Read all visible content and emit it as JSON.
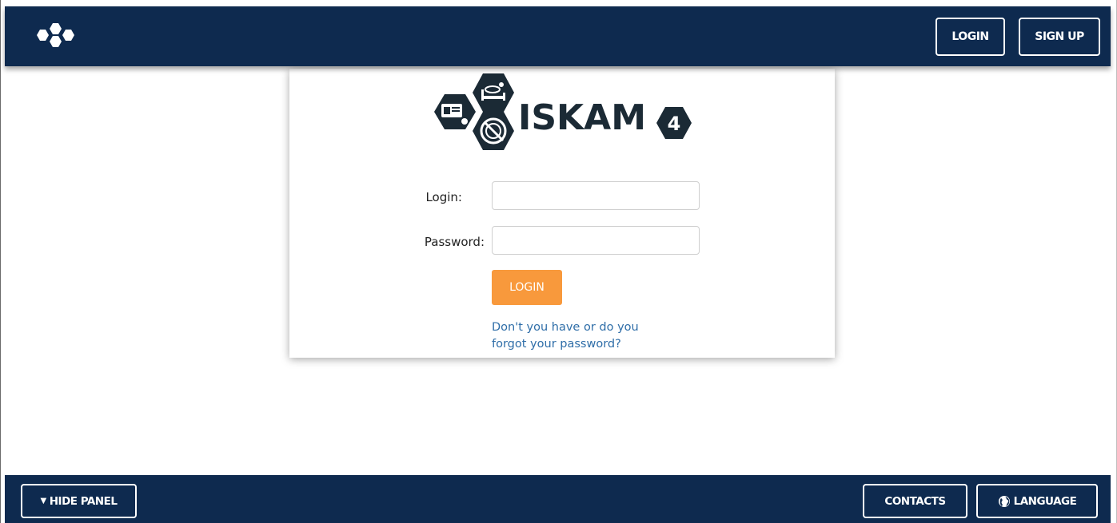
{
  "header": {
    "login_label": "LOGIN",
    "signup_label": "SIGN UP",
    "logo_icon": "hexagon-cluster-logo"
  },
  "brand": {
    "name": "ISKAM",
    "version": "4"
  },
  "form": {
    "login_label": "Login:",
    "password_label": "Password:",
    "login_value": "",
    "password_value": "",
    "submit_label": "LOGIN",
    "forgot_line1": "Don't you have or do you",
    "forgot_line2": "forgot your password?"
  },
  "footer": {
    "hide_panel_label": "HIDE PANEL",
    "contacts_label": "CONTACTS",
    "language_label": "LANGUAGE"
  },
  "colors": {
    "navy": "#0e2a4f",
    "orange": "#f8993c",
    "link": "#2f6ea8",
    "logo_dark": "#1b2a35"
  }
}
